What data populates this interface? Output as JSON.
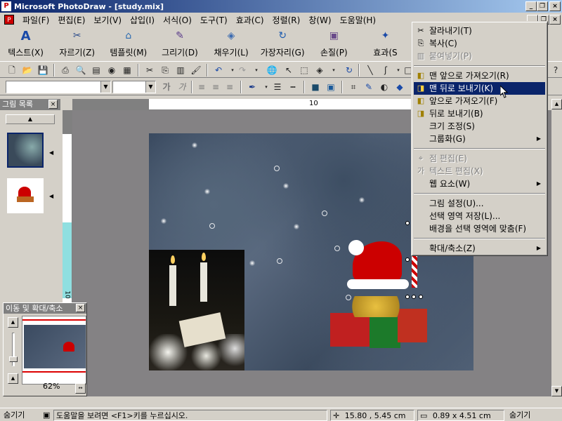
{
  "window": {
    "app_icon": "photodraw-icon",
    "title": "Microsoft PhotoDraw - [study.mix]",
    "minimize": "_",
    "maximize": "□",
    "restore": "❐",
    "close": "×"
  },
  "menubar": {
    "doc_icon": "document-icon",
    "items": [
      "파일(F)",
      "편집(E)",
      "보기(V)",
      "삽입(I)",
      "서식(O)",
      "도구(T)",
      "효과(C)",
      "정렬(R)",
      "창(W)",
      "도움말(H)"
    ]
  },
  "big_toolbar": [
    {
      "label": "텍스트(X)",
      "icon": "text-icon"
    },
    {
      "label": "자르기(Z)",
      "icon": "scissors-icon"
    },
    {
      "label": "템플릿(M)",
      "icon": "template-icon"
    },
    {
      "label": "그리기(D)",
      "icon": "pen-icon"
    },
    {
      "label": "채우기(L)",
      "icon": "fill-bucket-icon"
    },
    {
      "label": "가장자리(G)",
      "icon": "edge-icon"
    },
    {
      "label": "손질(P)",
      "icon": "touchup-icon"
    },
    {
      "label": "효과(S",
      "icon": "effects-icon"
    }
  ],
  "format_bar": {
    "font_value": "",
    "size_value": "",
    "bold_glyph": "가",
    "italic_glyph": "가"
  },
  "picture_list": {
    "title": "그림 목록",
    "close": "×",
    "scroll_up": "▲",
    "expand": "◀"
  },
  "ruler": {
    "h_label": "10",
    "v_label": "10"
  },
  "pan_zoom": {
    "title": "이동 및 확대/축소",
    "close": "×",
    "zoom_percent": "62%",
    "fit_icon": "fit-window-icon",
    "zoom_in_icon": "zoom-in-icon",
    "zoom_out_icon": "zoom-out-icon"
  },
  "context_menu": {
    "items": [
      {
        "label": "잘라내기(T)",
        "icon": "scissors-icon",
        "glyph": "✂",
        "disabled": false,
        "selected": false,
        "submenu": false
      },
      {
        "label": "복사(C)",
        "icon": "copy-icon",
        "glyph": "⎘",
        "disabled": false,
        "selected": false,
        "submenu": false
      },
      {
        "label": "붙여넣기(P)",
        "icon": "paste-icon",
        "glyph": "📋",
        "disabled": true,
        "selected": false,
        "submenu": false
      },
      {
        "label": "맨 앞으로 가져오기(R)",
        "icon": "bring-to-front-icon",
        "glyph": "◧",
        "disabled": false,
        "selected": false,
        "submenu": false
      },
      {
        "label": "맨 뒤로 보내기(K)",
        "icon": "send-to-back-icon",
        "glyph": "◨",
        "disabled": false,
        "selected": true,
        "submenu": false
      },
      {
        "label": "앞으로 가져오기(F)",
        "icon": "bring-forward-icon",
        "glyph": "◧",
        "disabled": false,
        "selected": false,
        "submenu": false
      },
      {
        "label": "뒤로 보내기(B)",
        "icon": "send-backward-icon",
        "glyph": "◨",
        "disabled": false,
        "selected": false,
        "submenu": false
      },
      {
        "label": "크기 조정(S)",
        "icon": "",
        "glyph": "",
        "disabled": false,
        "selected": false,
        "submenu": false
      },
      {
        "label": "그룹화(G)",
        "icon": "",
        "glyph": "",
        "disabled": false,
        "selected": false,
        "submenu": true
      },
      {
        "label": "점 편집(E)",
        "icon": "edit-points-icon",
        "glyph": "⌖",
        "disabled": true,
        "selected": false,
        "submenu": false
      },
      {
        "label": "텍스트 편집(X)",
        "icon": "edit-text-icon",
        "glyph": "가",
        "disabled": true,
        "selected": false,
        "submenu": false
      },
      {
        "label": "웹 요소(W)",
        "icon": "",
        "glyph": "",
        "disabled": false,
        "selected": false,
        "submenu": true
      },
      {
        "label": "그림 설정(U)...",
        "icon": "",
        "glyph": "",
        "disabled": false,
        "selected": false,
        "submenu": false
      },
      {
        "label": "선택 영역 저장(L)...",
        "icon": "",
        "glyph": "",
        "disabled": false,
        "selected": false,
        "submenu": false
      },
      {
        "label": "배경을 선택 영역에 맞춤(F)",
        "icon": "",
        "glyph": "",
        "disabled": false,
        "selected": false,
        "submenu": false
      },
      {
        "label": "확대/축소(Z)",
        "icon": "",
        "glyph": "",
        "disabled": false,
        "selected": false,
        "submenu": true
      }
    ],
    "submenu_arrow": "▶"
  },
  "status_bar": {
    "hide_left": "숨기기",
    "help_text": "도움말을 보려면 <F1>키를 누르십시오.",
    "position": "15.80 , 5.45  cm",
    "size": "0.89 x 4.51  cm",
    "hide_right": "숨기기"
  },
  "colors": {
    "titlebar_start": "#0a246a",
    "titlebar_end": "#a6caf0",
    "menu_highlight": "#0a246a",
    "face": "#d4d0c8"
  }
}
